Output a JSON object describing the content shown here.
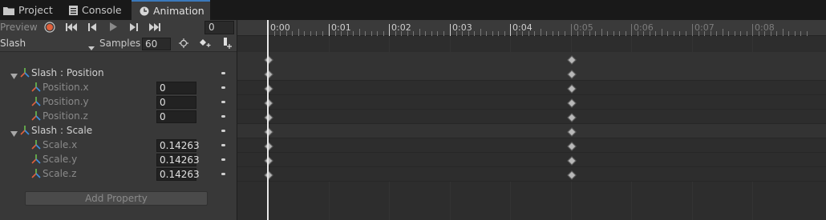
{
  "tabs": [
    {
      "label": "Project",
      "icon": "folder-icon"
    },
    {
      "label": "Console",
      "icon": "console-icon"
    },
    {
      "label": "Animation",
      "icon": "clock-icon"
    }
  ],
  "toolbar": {
    "preview_label": "Preview",
    "frame_value": "0",
    "clip_name": "Slash",
    "samples_label": "Samples",
    "samples_value": "60"
  },
  "properties": [
    {
      "label": "Slash : Position",
      "group": true,
      "value": ""
    },
    {
      "label": "Position.x",
      "group": false,
      "value": "0"
    },
    {
      "label": "Position.y",
      "group": false,
      "value": "0"
    },
    {
      "label": "Position.z",
      "group": false,
      "value": "0"
    },
    {
      "label": "Slash : Scale",
      "group": true,
      "value": ""
    },
    {
      "label": "Scale.x",
      "group": false,
      "value": "0.14263"
    },
    {
      "label": "Scale.y",
      "group": false,
      "value": "0.14263"
    },
    {
      "label": "Scale.z",
      "group": false,
      "value": "0.14263"
    }
  ],
  "add_property_label": "Add Property",
  "timeline": {
    "ticks": [
      "0:00",
      "0:01",
      "0:02",
      "0:03",
      "0:04",
      "0:05",
      "0:06",
      "0:07",
      "0:08"
    ],
    "clip_end_tick": "0:05",
    "keyframe_times": [
      "0:00",
      "0:05"
    ]
  },
  "colors": {
    "accent": "#3a79bb",
    "record": "#e0613c",
    "background": "#282828"
  }
}
